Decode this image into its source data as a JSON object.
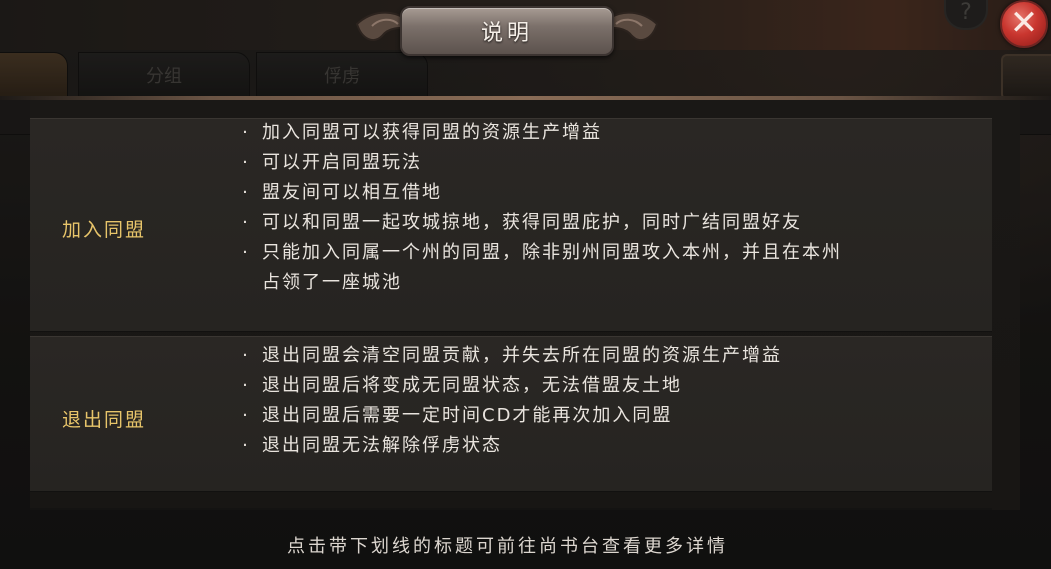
{
  "dialog": {
    "title": "说明",
    "sections": [
      {
        "title": "加入同盟",
        "items": [
          "加入同盟可以获得同盟的资源生产增益",
          "可以开启同盟玩法",
          "盟友间可以相互借地",
          "可以和同盟一起攻城掠地，获得同盟庇护，同时广结同盟好友",
          "只能加入同属一个州的同盟，除非别州同盟攻入本州，并且在本州占领了一座城池"
        ]
      },
      {
        "title": "退出同盟",
        "items": [
          "退出同盟会清空同盟贡献，并失去所在同盟的资源生产增益",
          "退出同盟后将变成无同盟状态，无法借盟友土地",
          "退出同盟后需要一定时间CD才能再次加入同盟",
          "退出同盟无法解除俘虏状态"
        ]
      }
    ],
    "footer_hint": "点击带下划线的标题可前往尚书台查看更多详情",
    "bullet_char": "·"
  },
  "background": {
    "tabs": [
      "分组",
      "俘虏"
    ],
    "help_label": "?",
    "close_label": "✕"
  },
  "icons": {
    "help": "question-icon",
    "close": "close-icon"
  },
  "colors": {
    "section_title": "#e8c56a",
    "body_text": "#e9e4de",
    "close_button": "#c9362f"
  }
}
